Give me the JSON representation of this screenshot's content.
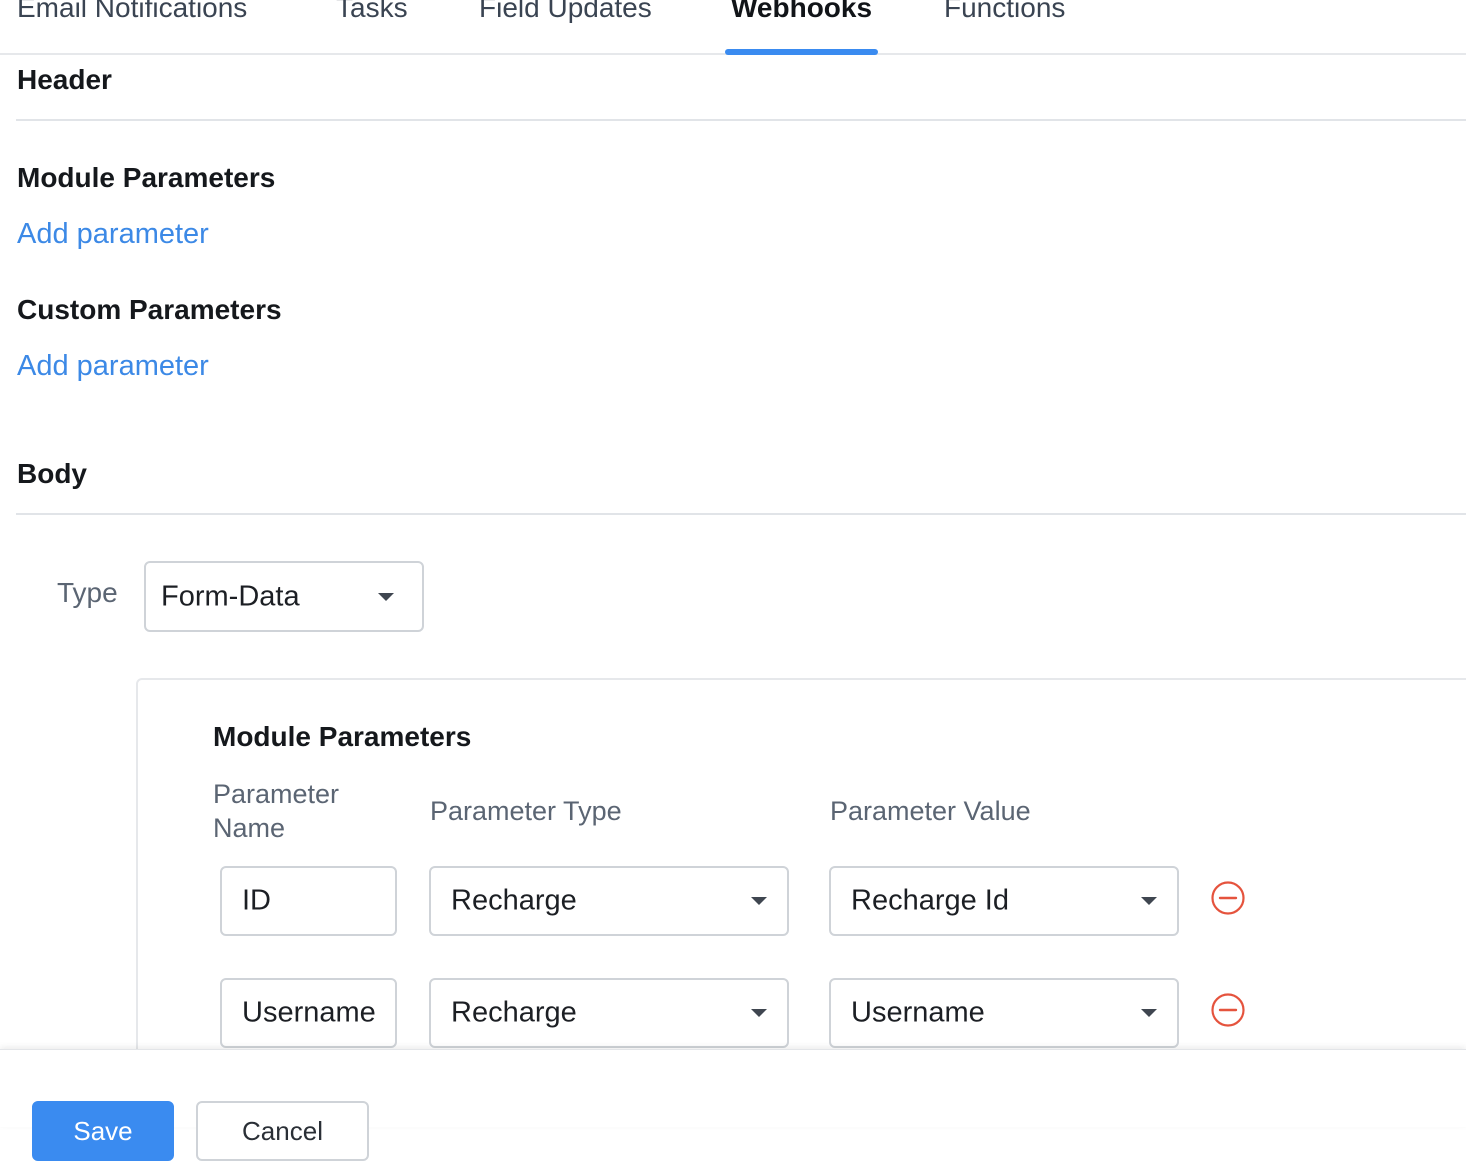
{
  "tabs": [
    {
      "label": "Email Notifications",
      "active": false
    },
    {
      "label": "Tasks",
      "active": false
    },
    {
      "label": "Field Updates",
      "active": false
    },
    {
      "label": "Webhooks",
      "active": true
    },
    {
      "label": "Functions",
      "active": false
    }
  ],
  "header_section": {
    "title": "Header"
  },
  "module_parameters": {
    "title": "Module Parameters",
    "add_link": "Add parameter"
  },
  "custom_parameters": {
    "title": "Custom Parameters",
    "add_link": "Add parameter"
  },
  "body_section": {
    "title": "Body",
    "type_label": "Type",
    "type_value": "Form-Data"
  },
  "body_module_parameters": {
    "title": "Module Parameters",
    "columns": {
      "name": "Parameter Name",
      "type": "Parameter Type",
      "value": "Parameter Value"
    },
    "rows": [
      {
        "name": "ID",
        "type": "Recharge",
        "value": "Recharge Id"
      },
      {
        "name": "Username",
        "type": "Recharge",
        "value": "Username"
      }
    ]
  },
  "footer": {
    "save_label": "Save",
    "cancel_label": "Cancel"
  },
  "colors": {
    "accent": "#3a8bf0",
    "link": "#3c89e6",
    "remove": "#e5533d"
  },
  "icons": {
    "dropdown": "caret-down-icon",
    "remove": "minus-circle-icon"
  }
}
